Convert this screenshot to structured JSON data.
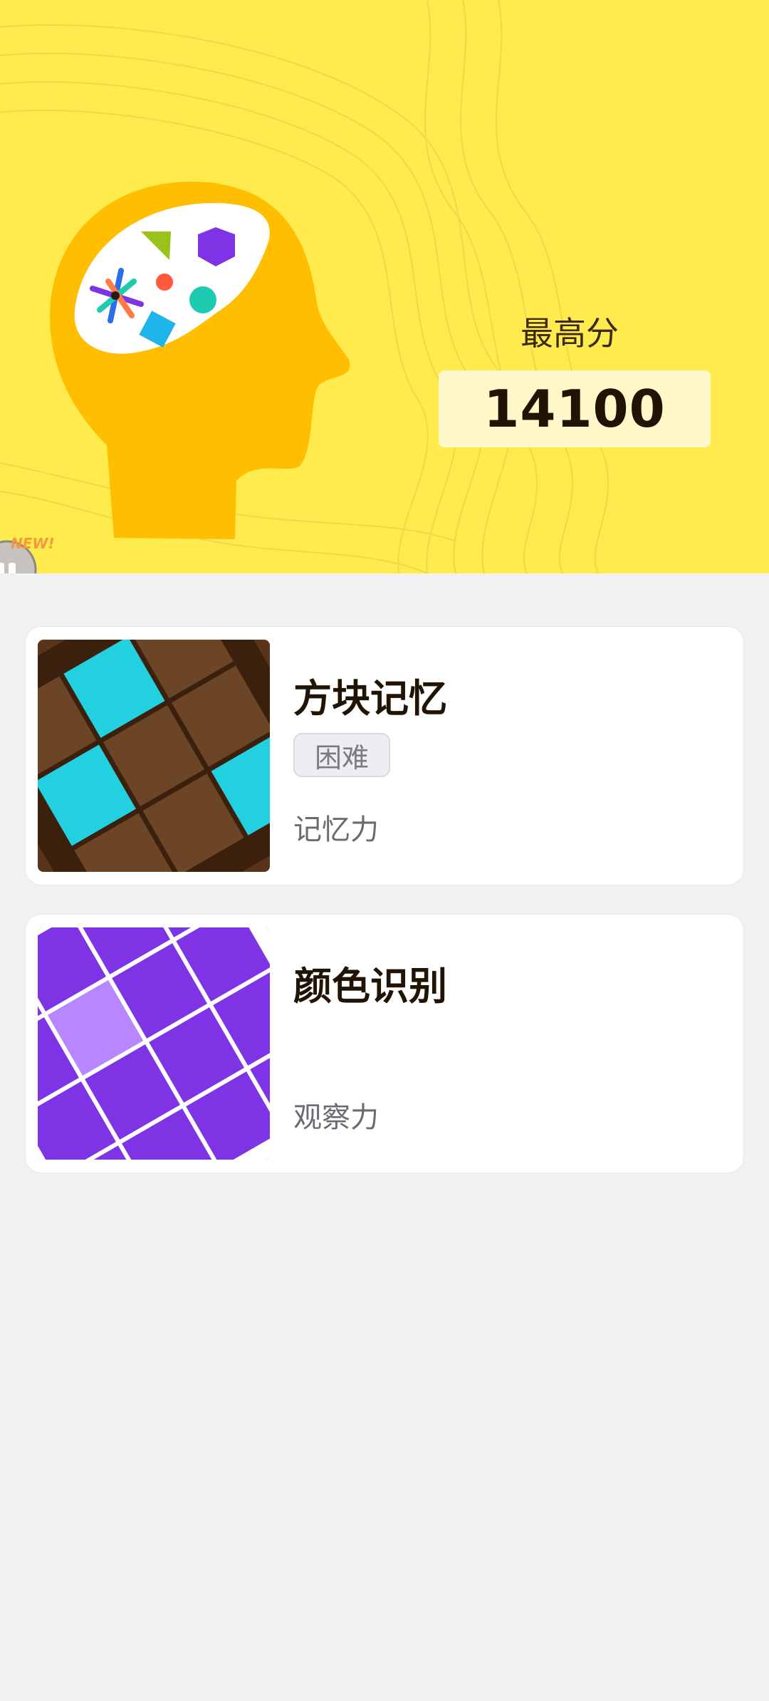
{
  "hero": {
    "best_label": "最高分",
    "best_score": "14100",
    "new_badge": "NEW!",
    "illustration_icon": "brain-head-icon"
  },
  "games": [
    {
      "title": "方块记忆",
      "difficulty": "困难",
      "skill": "记忆力",
      "thumb_icon": "block-memory-thumbnail"
    },
    {
      "title": "颜色识别",
      "difficulty": "",
      "skill": "观察力",
      "thumb_icon": "color-recognition-thumbnail"
    }
  ],
  "colors": {
    "hero_bg": "#ffeb4d",
    "head": "#ffbe00",
    "brain_blue_tile": "#22d0e0",
    "brown_tile": "#6b4526",
    "purple_tile": "#7e34e4",
    "purple_highlight": "#b886ff"
  }
}
